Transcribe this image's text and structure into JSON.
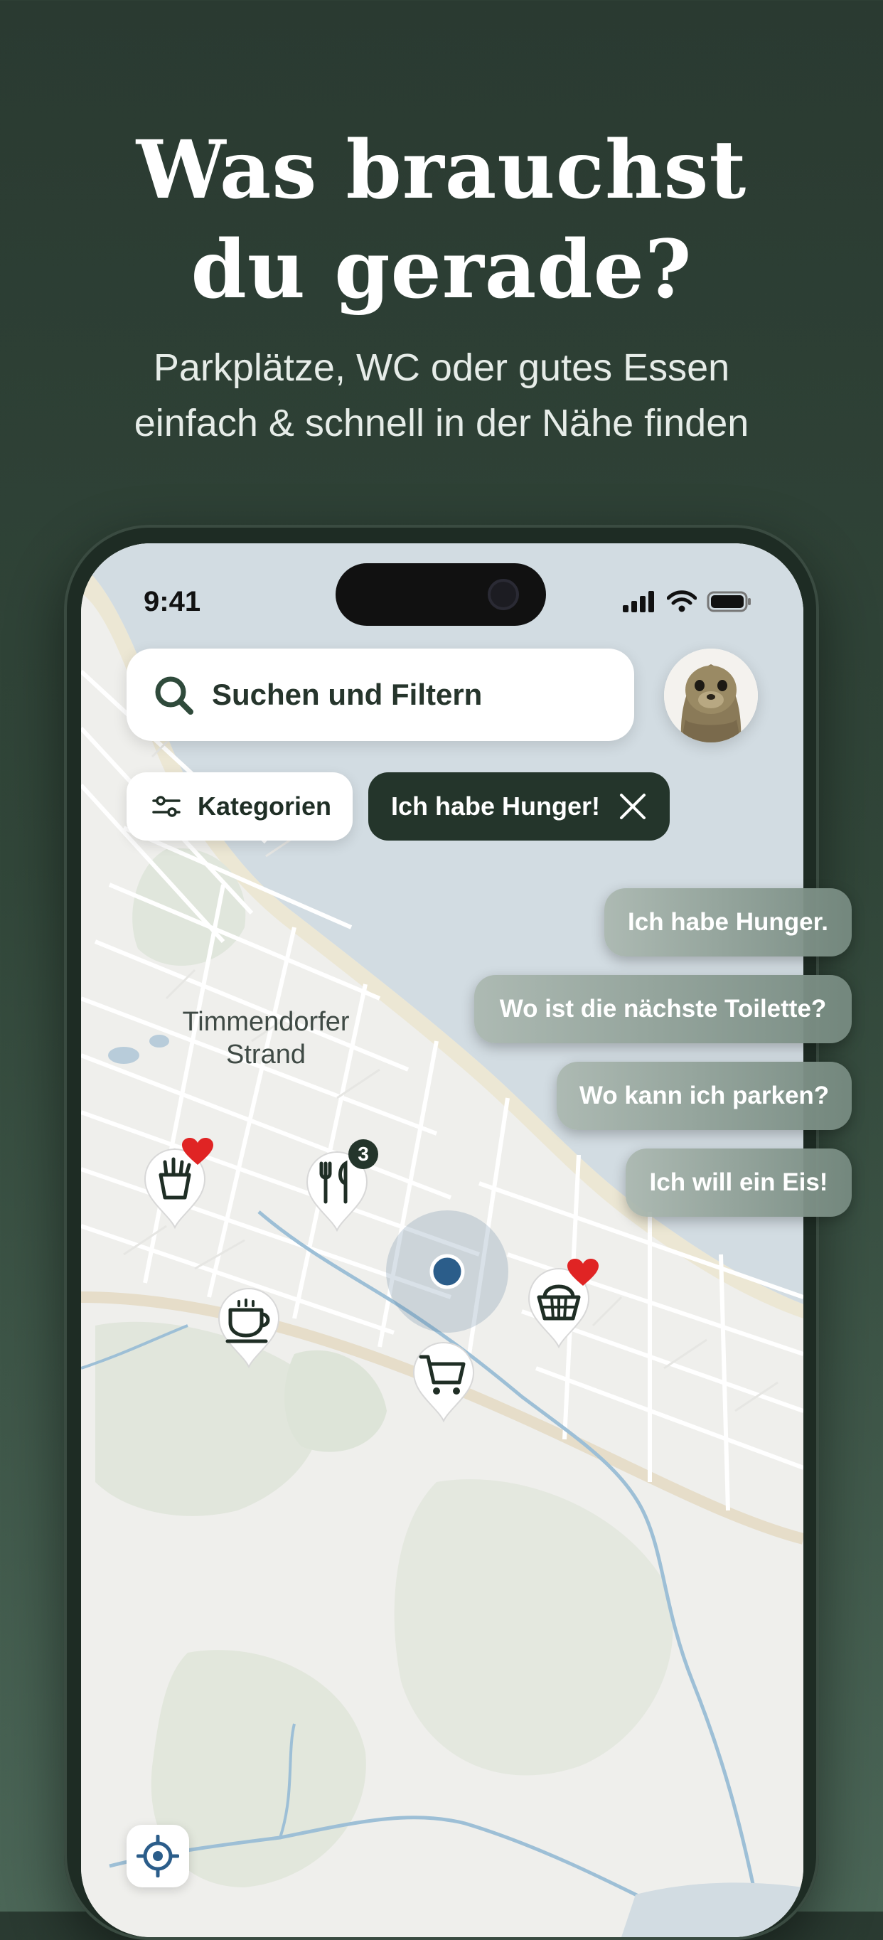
{
  "promo": {
    "headline_line1": "Was brauchst",
    "headline_line2": "du gerade?",
    "subline_line1": "Parkplätze, WC oder gutes Essen",
    "subline_line2": "einfach & schnell in der Nähe finden"
  },
  "status_bar": {
    "time": "9:41",
    "icons": [
      "signal-icon",
      "wifi-icon",
      "battery-icon"
    ]
  },
  "search": {
    "label": "Suchen und Filtern",
    "icon": "search-icon"
  },
  "avatar": {
    "icon": "seal-avatar"
  },
  "chips": {
    "categories_label": "Kategorien",
    "active_filter_label": "Ich habe Hunger!"
  },
  "suggestions": [
    "Ich habe Hunger.",
    "Wo ist die nächste Toilette?",
    "Wo kann ich parken?",
    "Ich will ein Eis!"
  ],
  "map": {
    "place_label_line1": "Timmendorfer",
    "place_label_line2": "Strand",
    "pins": [
      {
        "icon": "fast-food-icon",
        "favorite": true
      },
      {
        "icon": "restaurant-icon",
        "badge": "3"
      },
      {
        "icon": "coffee-icon"
      },
      {
        "icon": "shopping-cart-icon"
      },
      {
        "icon": "basket-icon",
        "favorite": true
      }
    ],
    "locate_icon": "crosshair-icon"
  },
  "colors": {
    "background": "#2f4337",
    "accent_dark": "#24352b",
    "user_location": "#2b5d8a",
    "favorite": "#e02424",
    "water": "#d2dce2"
  }
}
